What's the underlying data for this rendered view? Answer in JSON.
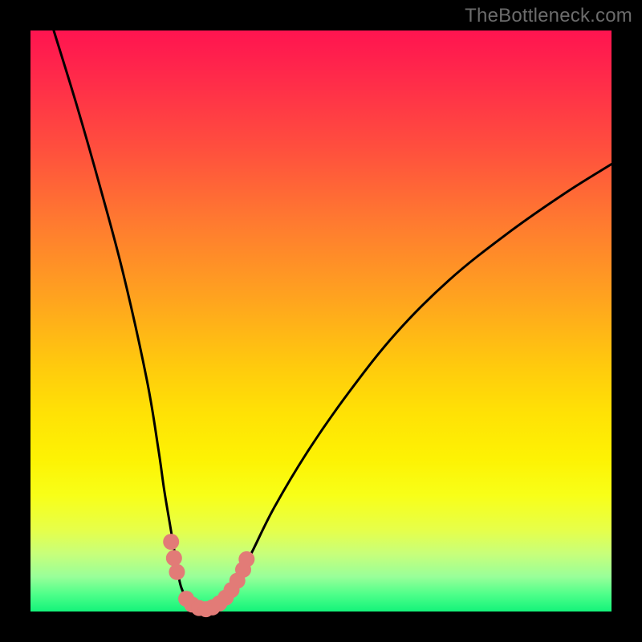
{
  "watermark": "TheBottleneck.com",
  "chart_data": {
    "type": "line",
    "title": "",
    "xlabel": "",
    "ylabel": "",
    "xlim": [
      0,
      100
    ],
    "ylim": [
      0,
      100
    ],
    "grid": false,
    "legend": false,
    "series": [
      {
        "name": "left-branch",
        "x": [
          4,
          8,
          12,
          16,
          20,
          22,
          23,
          24,
          25,
          25.5,
          26,
          27,
          28,
          29,
          30
        ],
        "values": [
          100,
          87,
          73,
          58,
          40,
          28,
          21,
          15,
          9,
          6,
          4,
          2,
          1,
          0.3,
          0
        ]
      },
      {
        "name": "right-branch",
        "x": [
          30,
          31,
          32,
          33,
          34,
          36,
          38,
          42,
          48,
          55,
          63,
          72,
          82,
          92,
          100
        ],
        "values": [
          0,
          0.5,
          1.2,
          2.2,
          3.5,
          6.5,
          10,
          18,
          28,
          38,
          48,
          57,
          65,
          72,
          77
        ]
      }
    ],
    "marker_points": {
      "comment": "salmon dots near trough",
      "color": "#e27b77",
      "points": [
        {
          "x": 24.2,
          "y": 12
        },
        {
          "x": 24.7,
          "y": 9.2
        },
        {
          "x": 25.2,
          "y": 6.8
        },
        {
          "x": 26.8,
          "y": 2.2
        },
        {
          "x": 27.8,
          "y": 1.2
        },
        {
          "x": 29.0,
          "y": 0.6
        },
        {
          "x": 30.2,
          "y": 0.4
        },
        {
          "x": 31.3,
          "y": 0.7
        },
        {
          "x": 32.5,
          "y": 1.4
        },
        {
          "x": 33.6,
          "y": 2.4
        },
        {
          "x": 34.6,
          "y": 3.7
        },
        {
          "x": 35.6,
          "y": 5.3
        },
        {
          "x": 36.6,
          "y": 7.2
        },
        {
          "x": 37.2,
          "y": 9.0
        }
      ]
    },
    "gradient_stops": [
      {
        "pos": 0,
        "color": "#ff1450"
      },
      {
        "pos": 8,
        "color": "#ff2a4a"
      },
      {
        "pos": 20,
        "color": "#ff4e3e"
      },
      {
        "pos": 33,
        "color": "#ff7a30"
      },
      {
        "pos": 46,
        "color": "#ffa31f"
      },
      {
        "pos": 58,
        "color": "#ffcb0d"
      },
      {
        "pos": 66,
        "color": "#ffe205"
      },
      {
        "pos": 74,
        "color": "#fdf304"
      },
      {
        "pos": 80,
        "color": "#f8ff18"
      },
      {
        "pos": 86,
        "color": "#e6ff4a"
      },
      {
        "pos": 90,
        "color": "#c8ff7a"
      },
      {
        "pos": 94,
        "color": "#99ff99"
      },
      {
        "pos": 97,
        "color": "#4fff8a"
      },
      {
        "pos": 100,
        "color": "#14f37a"
      }
    ]
  }
}
